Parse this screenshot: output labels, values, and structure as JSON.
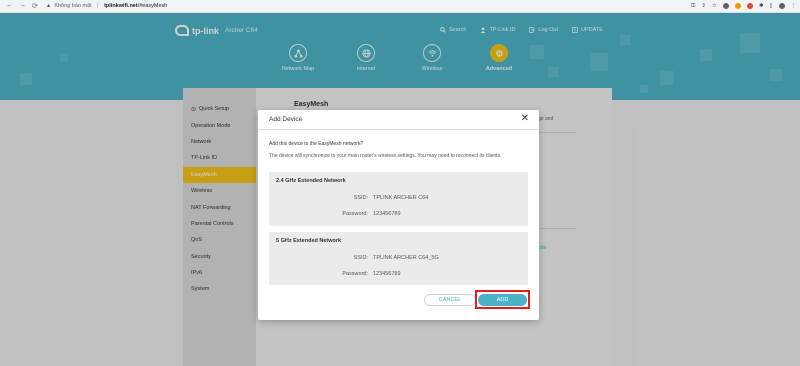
{
  "browser": {
    "security_warning": "Không bảo mật",
    "url_host": "tplinkwifi.net",
    "url_path": "/#easyMesh"
  },
  "header": {
    "brand": "tp-link",
    "model": "Archer C64",
    "links": [
      {
        "label": "Search",
        "icon": "search-icon"
      },
      {
        "label": "TP-Link ID",
        "icon": "user-icon"
      },
      {
        "label": "Log Out",
        "icon": "logout-icon"
      },
      {
        "label": "UPDATE",
        "icon": "update-icon"
      }
    ],
    "tabs": [
      {
        "label": "Network Map",
        "icon": "network-map-icon"
      },
      {
        "label": "Internet",
        "icon": "globe-icon"
      },
      {
        "label": "Wireless",
        "icon": "wifi-icon"
      },
      {
        "label": "Advanced",
        "icon": "gear-icon",
        "active": true
      }
    ]
  },
  "sidebar": {
    "items": [
      {
        "label": "Quick Setup",
        "icon": "quick-setup-icon"
      },
      {
        "label": "Operation Mode"
      },
      {
        "label": "Network"
      },
      {
        "label": "TP-Link ID"
      },
      {
        "label": "EasyMesh",
        "active": true
      },
      {
        "label": "Wireless"
      },
      {
        "label": "NAT Forwarding"
      },
      {
        "label": "Parental Controls"
      },
      {
        "label": "QoS"
      },
      {
        "label": "Security"
      },
      {
        "label": "IPv6"
      },
      {
        "label": "System"
      }
    ]
  },
  "content": {
    "title": "EasyMesh",
    "partial_right_1": "ge and",
    "partial_right_2": "ode"
  },
  "modal": {
    "title": "Add Device",
    "prompt": "Add this device to the EasyMesh network?",
    "description": "The device will synchronize to your main router's wireless settings. You may need to reconnect its clients.",
    "networks": [
      {
        "title": "2.4 GHz Extended Network",
        "ssid_label": "SSID:",
        "ssid": "TPLINK ARCHER C64",
        "password_label": "Password:",
        "password": "123456789"
      },
      {
        "title": "5 GHz Extended Network",
        "ssid_label": "SSID:",
        "ssid": "TPLINK ARCHER C64_5G",
        "password_label": "Password:",
        "password": "123456789"
      }
    ],
    "cancel_label": "CANCEL",
    "add_label": "ADD"
  },
  "colors": {
    "header_bg": "#4cb3c6",
    "accent_yellow": "#f2c21a",
    "highlight_red": "#e02020"
  }
}
